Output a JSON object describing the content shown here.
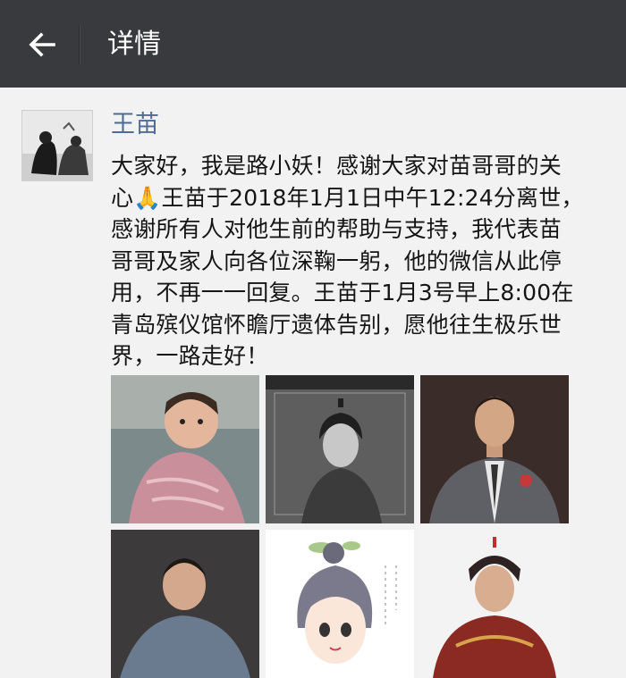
{
  "header": {
    "title": "详情",
    "back_icon": "arrow-left-icon"
  },
  "post": {
    "author": "王苗",
    "text": "大家好，我是路小妖！感谢大家对苗哥哥的关\n心🙏王苗于2018年1月1日中午12:24分离世，\n感谢所有人对他生前的帮助与支持，我代表苗\n哥哥及家人向各位深鞠一躬，他的微信从此停\n用，不再一一回复。王苗于1月3号早上8:00在\n青岛殡仪馆怀瞻厅遗体告别，愿他往生极乐世\n界，一路走好！",
    "photos": [
      {
        "name": "baby-photo"
      },
      {
        "name": "costume-portrait-photo"
      },
      {
        "name": "suit-portrait-photo"
      },
      {
        "name": "outdoor-portrait-photo"
      },
      {
        "name": "cartoon-drawing-photo"
      },
      {
        "name": "armor-costume-photo"
      }
    ]
  }
}
